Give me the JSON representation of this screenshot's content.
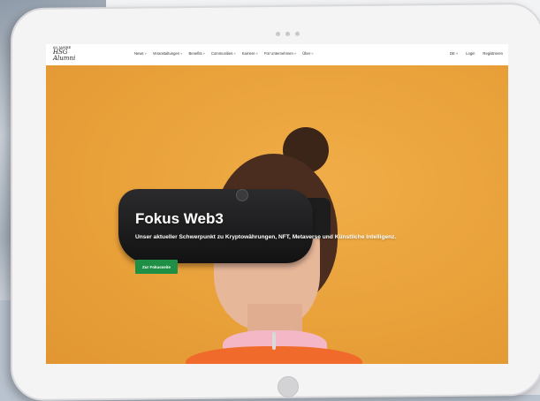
{
  "brand": {
    "logo_line1": "60 JAHRE",
    "logo_line2": "HSG",
    "logo_line3": "Alumni"
  },
  "nav": {
    "items": [
      {
        "label": "News"
      },
      {
        "label": "Veranstaltungen"
      },
      {
        "label": "Benefits"
      },
      {
        "label": "Communities"
      },
      {
        "label": "Karriere"
      },
      {
        "label": "Für Unternehmen"
      },
      {
        "label": "Über"
      }
    ],
    "language": "DE",
    "login": "Login",
    "register": "Registrieren"
  },
  "hero": {
    "title": "Fokus Web3",
    "subtitle": "Unser aktueller Schwerpunkt zu Kryptowährungen, NFT, Metaverse und Künstliche Intelligenz.",
    "cta_label": "Zur Fokusseite"
  },
  "colors": {
    "hero_background": "#e9a43b",
    "cta": "#1e8f44",
    "vest": "#f06a2c"
  }
}
